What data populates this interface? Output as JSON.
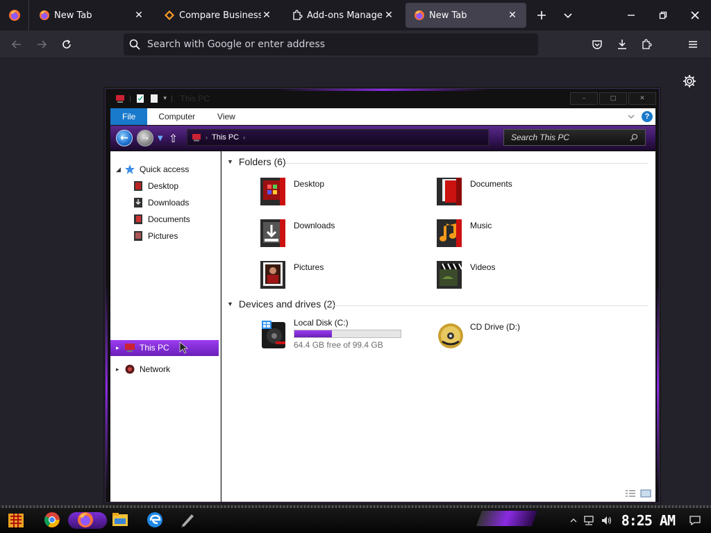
{
  "browser": {
    "tabs": [
      {
        "label": "New Tab",
        "icon": "firefox-icon",
        "active": false
      },
      {
        "label": "Compare Business So",
        "icon": "capterra-icon",
        "active": false
      },
      {
        "label": "Add-ons Manager",
        "icon": "puzzle-icon",
        "active": false
      },
      {
        "label": "New Tab",
        "icon": "firefox-icon",
        "active": true
      }
    ],
    "address_placeholder": "Search with Google or enter address"
  },
  "explorer": {
    "title": "This PC",
    "ribbon_tabs": [
      "File",
      "Computer",
      "View"
    ],
    "breadcrumb": "This PC",
    "search_placeholder": "Search This PC",
    "window_buttons": [
      "–",
      "□",
      "✕"
    ],
    "nav": {
      "quick_access": "Quick access",
      "quick_items": [
        "Desktop",
        "Downloads",
        "Documents",
        "Pictures"
      ],
      "this_pc": "This PC",
      "network": "Network"
    },
    "folders_header": "Folders (6)",
    "folders": [
      "Desktop",
      "Documents",
      "Downloads",
      "Music",
      "Pictures",
      "Videos"
    ],
    "devices_header": "Devices and drives (2)",
    "drives": [
      {
        "name": "Local Disk (C:)",
        "free": "64.4 GB free of 99.4 GB",
        "used_fraction": 0.352
      },
      {
        "name": "CD Drive (D:)"
      }
    ]
  },
  "taskbar": {
    "clock": "8:25 AM"
  },
  "colors": {
    "accent_purple": "#8a2be2",
    "ribbon_blue": "#1979ca",
    "browser_bg": "#23222b"
  }
}
